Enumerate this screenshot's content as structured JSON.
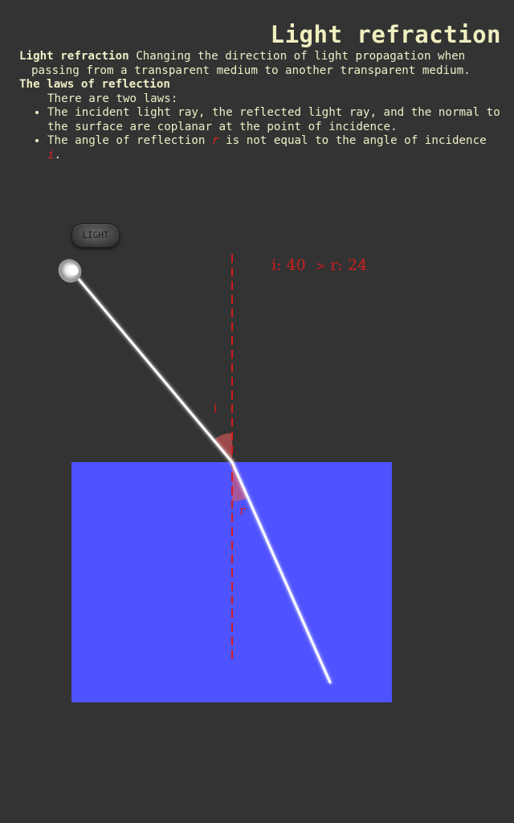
{
  "page": {
    "title": "Light refraction"
  },
  "definition": {
    "term": "Light refraction",
    "text": "Changing the direction of light propagation when passing from a transparent medium to another transparent medium."
  },
  "laws": {
    "heading": "The laws of reflection",
    "intro": "There are two laws:",
    "law1": "The incident light ray, the reflected light ray, and the normal to the surface are coplanar at the point of incidence.",
    "law2_before": "The angle of reflection ",
    "law2_r": "r",
    "law2_middle": " is not equal to the angle of incidence ",
    "law2_i": "i",
    "law2_after": "."
  },
  "controls": {
    "light_button": "LIGHT"
  },
  "readout": {
    "i_label": "i:",
    "i_value": "40",
    "comparison": ">",
    "r_label": "r:",
    "r_value": "24"
  },
  "diagram": {
    "incidence_angle_deg": 40,
    "refraction_angle_deg": 24,
    "angle_i_label": "i",
    "angle_r_label": "r",
    "colors": {
      "medium": "#4f52ff",
      "normal_line": "#d51b1b",
      "ray": "#ffffff",
      "angle_fill": "#e35a5a",
      "background": "#333333"
    }
  }
}
